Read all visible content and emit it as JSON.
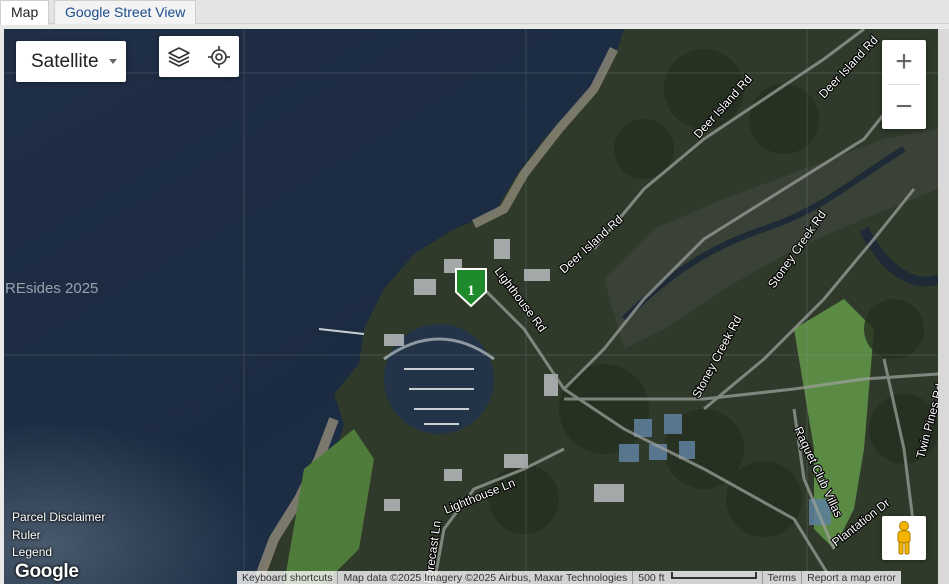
{
  "tabs": [
    {
      "label": "Map",
      "active": true
    },
    {
      "label": "Google Street View",
      "active": false
    }
  ],
  "map_type": {
    "selected": "Satellite"
  },
  "tools": {
    "layers_icon": "layers-icon",
    "locate_icon": "my-location-icon"
  },
  "zoom": {
    "in_label": "+",
    "out_label": "−"
  },
  "marker": {
    "label": "1",
    "color": "#1e8a2c"
  },
  "watermark": "REsides 2025",
  "road_labels": [
    "Deer Island Rd",
    "Deer Island Rd",
    "Deer Island Rd",
    "Lighthouse Rd",
    "Stoney Creek Rd",
    "Stoney Creek Rd",
    "Raquet Club Villas",
    "Twin Pines Rd",
    "Plantation Dr",
    "Lighthouse Ln",
    "Forecast Ln"
  ],
  "left_links": [
    "Parcel Disclaimer",
    "Ruler",
    "Legend"
  ],
  "google_logo": "Google",
  "attribution": {
    "shortcuts": "Keyboard shortcuts",
    "map_data": "Map data ©2025 Imagery ©2025 Airbus, Maxar Technologies",
    "scale": "500 ft",
    "terms": "Terms",
    "report": "Report a map error"
  }
}
